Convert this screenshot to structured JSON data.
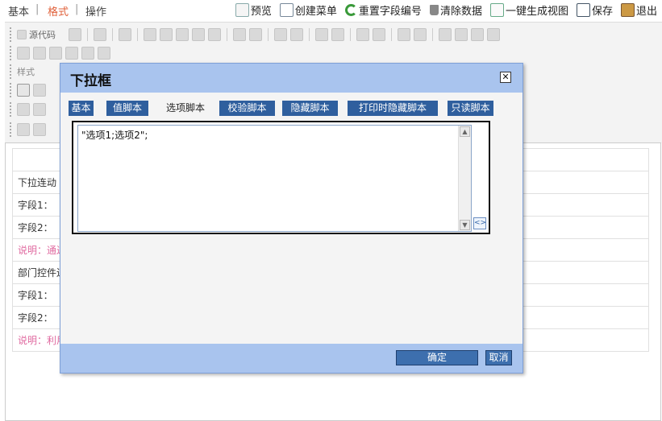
{
  "top_tabs": [
    "基本",
    "格式",
    "操作"
  ],
  "actions": [
    {
      "icon": "preview-icon",
      "label": "预览"
    },
    {
      "icon": "create-menu-icon",
      "label": "创建菜单"
    },
    {
      "icon": "reset-icon",
      "label": "重置字段编号"
    },
    {
      "icon": "trash-icon",
      "label": "清除数据"
    },
    {
      "icon": "generate-view-icon",
      "label": "一键生成视图"
    },
    {
      "icon": "save-icon",
      "label": "保存"
    },
    {
      "icon": "exit-icon",
      "label": "退出"
    }
  ],
  "editor": {
    "source_label": "源代码",
    "style_label": "样式"
  },
  "document": {
    "rows": [
      "",
      "下拉连动",
      "字段1：",
      "字段2：",
      "说明：通过",
      "部门控件连",
      "字段1：",
      "字段2：",
      "说明：利用"
    ]
  },
  "dialog": {
    "title": "下拉框",
    "tabs": [
      "基本",
      "值脚本",
      "选项脚本",
      "校验脚本",
      "隐藏脚本",
      "打印时隐藏脚本",
      "只读脚本"
    ],
    "active_tab": "选项脚本",
    "script_value": "\"选项1;选项2\";",
    "ok_label": "确定",
    "cancel_label": "取消"
  },
  "colors": {
    "dialog_header": "#a9c4ee",
    "tab_bg": "#2f5f9e",
    "active_top_tab": "#e0603a",
    "note_text": "#e06aa0"
  }
}
